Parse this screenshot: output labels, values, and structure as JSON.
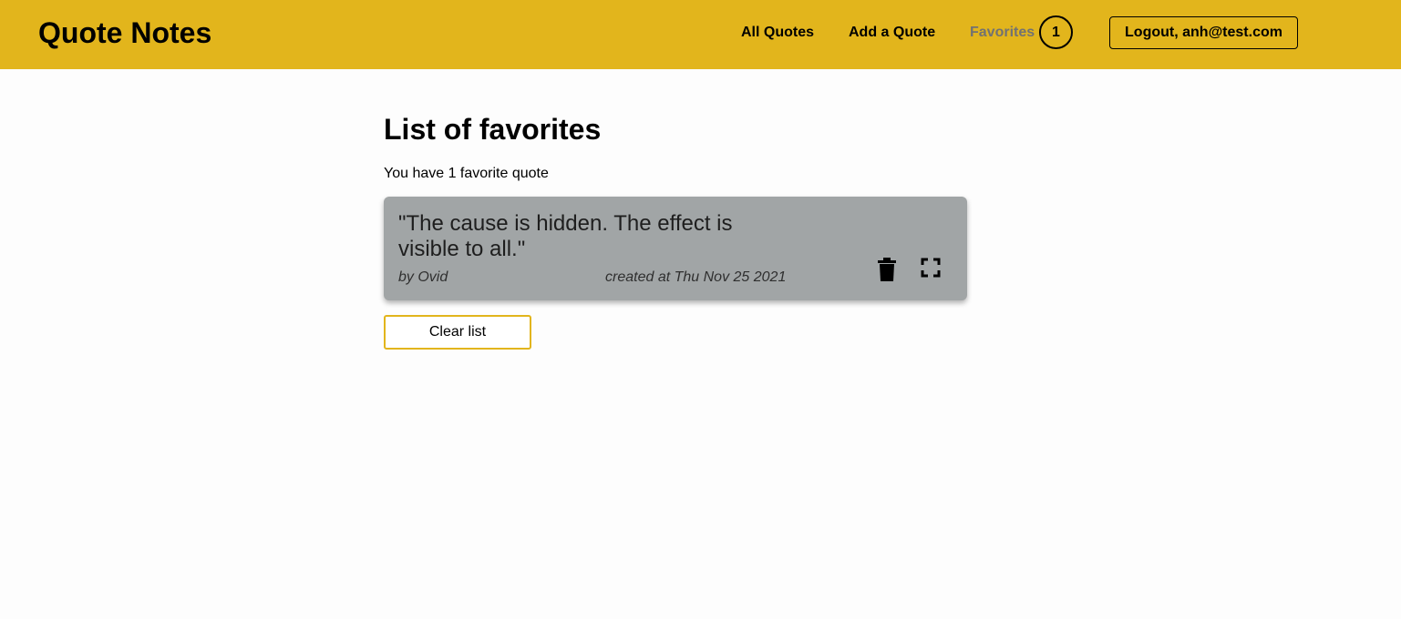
{
  "header": {
    "logo": "Quote Notes",
    "nav": {
      "all_quotes": "All Quotes",
      "add_quote": "Add a Quote",
      "favorites": "Favorites",
      "favorites_count": "1"
    },
    "logout_label": "Logout, anh@test.com",
    "accent_color": "#e2b51c"
  },
  "main": {
    "title": "List of favorites",
    "count_text": "You have 1 favorite quote",
    "quotes": [
      {
        "text": "\"The cause is hidden. The effect is visible to all.\"",
        "author": "by Ovid",
        "created": "created at Thu Nov 25 2021",
        "icons": [
          "trash-icon",
          "expand-icon"
        ]
      }
    ],
    "clear_label": "Clear list"
  }
}
